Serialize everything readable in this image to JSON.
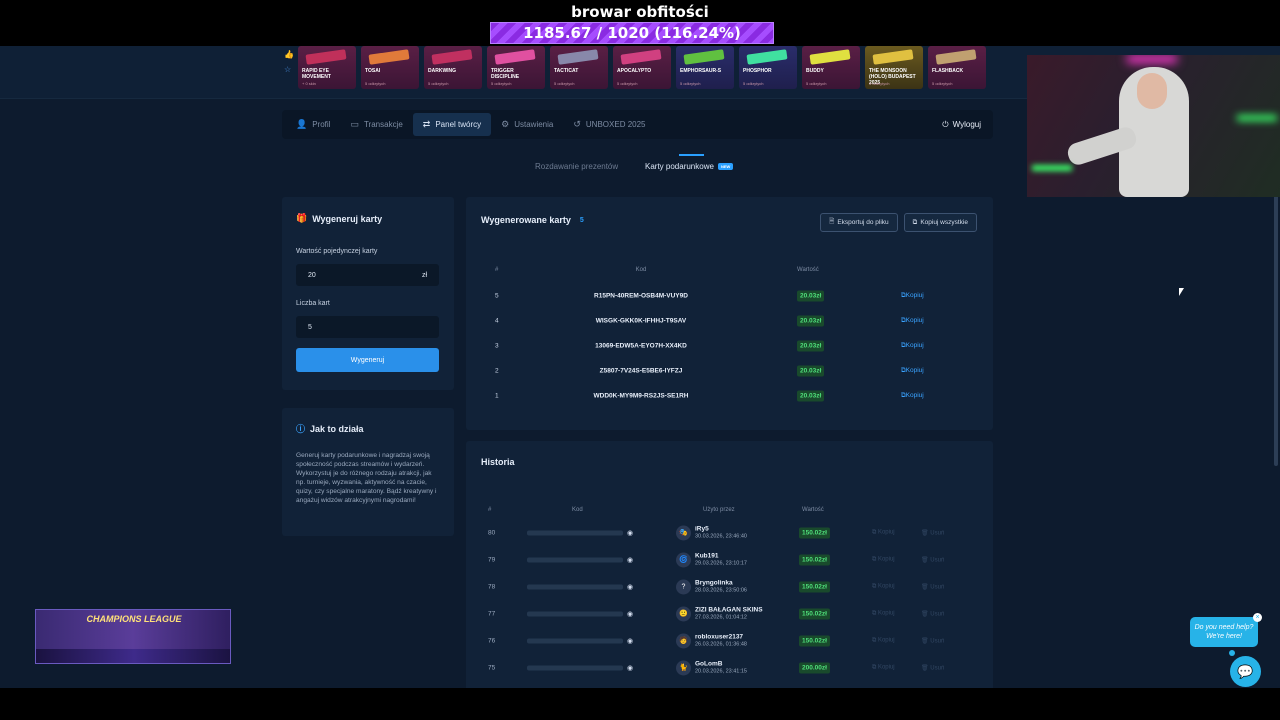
{
  "overlay": {
    "title": "browar obfitości",
    "progress_text": "1185.67 / 1020 (116.24%)",
    "progress_fraction": 1.1624
  },
  "skins": [
    {
      "name": "RAPID EYE MOVEMENT",
      "sub": "+ 0 skin",
      "color": "#c0305a"
    },
    {
      "name": "TOSAI",
      "sub": "5 odkrytych",
      "color": "#e07a3a"
    },
    {
      "name": "DARKWING",
      "sub": "5 odkrytych",
      "color": "#c03060"
    },
    {
      "name": "TRIGGER DISCIPLINE",
      "sub": "5 odkrytych",
      "color": "#e050a0"
    },
    {
      "name": "TACTICAT",
      "sub": "5 odkrytych",
      "color": "#8888aa"
    },
    {
      "name": "APOCALYPTO",
      "sub": "5 odkrytych",
      "color": "#d04080"
    },
    {
      "name": "EMPHORSAUR-S",
      "sub": "5 odkrytych",
      "color": "#60c040"
    },
    {
      "name": "PHOSPHOR",
      "sub": "5 odkrytych",
      "color": "#40e0a0"
    },
    {
      "name": "BUDDY",
      "sub": "5 odkrytych",
      "color": "#e0e040"
    },
    {
      "name": "THE MONSOON (HOLO) BUDAPEST 2025",
      "sub": "5 odkrytych",
      "color": "#e0c040"
    },
    {
      "name": "FLASHBACK",
      "sub": "5 odkrytych",
      "color": "#c0a070"
    }
  ],
  "tabs": [
    {
      "label": "Profil",
      "icon": "user-icon",
      "glyph": "👤"
    },
    {
      "label": "Transakcje",
      "icon": "wallet-icon",
      "glyph": "▭"
    },
    {
      "label": "Panel twórcy",
      "icon": "creator-icon",
      "glyph": "⇄"
    },
    {
      "label": "Ustawienia",
      "icon": "gear-icon",
      "glyph": "⚙"
    },
    {
      "label": "UNBOXED 2025",
      "icon": "history-icon",
      "glyph": "↺"
    }
  ],
  "logout_label": "Wyloguj",
  "subtabs": {
    "giveaways": "Rozdawanie prezentów",
    "gift_cards": "Karty podarunkowe",
    "new_badge": "NEW"
  },
  "generate": {
    "title": "Wygeneruj karty",
    "value_label": "Wartość pojedynczej karty",
    "value": "20",
    "currency": "zł",
    "count_label": "Liczba kart",
    "count": "5",
    "button": "Wygeneruj"
  },
  "how": {
    "title": "Jak to działa",
    "text": "Generuj karty podarunkowe i nagradzaj swoją społeczność podczas streamów i wydarzeń. Wykorzystuj je do różnego rodzaju atrakcji, jak np. turnieje, wyzwania, aktywność na czacie, quizy, czy specjalne maratony. Bądź kreatywny i angażuj widzów atrakcyjnymi nagrodami!"
  },
  "cards": {
    "title": "Wygenerowane karty",
    "count": "5",
    "export_label": "Eksportuj do pliku",
    "copy_all_label": "Kopiuj wszystkie",
    "headers": {
      "num": "#",
      "code": "Kod",
      "value": "Wartość"
    },
    "copy_label": "Kopiuj",
    "rows": [
      {
        "num": "5",
        "code": "R15PN-40REM-OSB4M-VUY9D",
        "value": "20.03zł"
      },
      {
        "num": "4",
        "code": "WISGK-GKK0K-IFHHJ-T9SAV",
        "value": "20.03zł"
      },
      {
        "num": "3",
        "code": "13069-EDW5A-EYO7H-XX4KD",
        "value": "20.03zł"
      },
      {
        "num": "2",
        "code": "Z5807-7V24S-E5BE6-IYFZJ",
        "value": "20.03zł"
      },
      {
        "num": "1",
        "code": "WDD0K-MY9M9-RS2JS-SE1RH",
        "value": "20.03zł"
      }
    ]
  },
  "history": {
    "title": "Historia",
    "headers": {
      "num": "#",
      "code": "Kod",
      "used_by": "Użyto przez",
      "value": "Wartość"
    },
    "copy_label": "Kopiuj",
    "delete_label": "Usuń",
    "rows": [
      {
        "num": "80",
        "user": "iRy5",
        "date": "30.03.2026, 23:46:40",
        "value": "150.02zł",
        "avatar": "🎭"
      },
      {
        "num": "79",
        "user": "Kub191",
        "date": "29.03.2026, 23:10:17",
        "value": "150.02zł",
        "avatar": "🌀"
      },
      {
        "num": "78",
        "user": "Bryngolinka",
        "date": "28.03.2026, 23:50:06",
        "value": "150.02zł",
        "avatar": "?"
      },
      {
        "num": "77",
        "user": "ZIZI BAŁAGAN SKINS",
        "date": "27.03.2026, 01:04:12",
        "value": "150.02zł",
        "avatar": "🙂"
      },
      {
        "num": "76",
        "user": "robloxuser2137",
        "date": "26.03.2026, 01:36:48",
        "value": "150.02zł",
        "avatar": "🧑"
      },
      {
        "num": "75",
        "user": "GoLomB",
        "date": "20.03.2026, 23:41:15",
        "value": "200.00zł",
        "avatar": "🐈"
      }
    ]
  },
  "overlay_bottom": {
    "champ_label": "CHAMPIONS LEAGUE"
  },
  "help": {
    "bubble": "Do you need help? We're here!"
  },
  "colors": {
    "accent": "#2a90ea",
    "value_green": "#4fe07a",
    "background": "#0d1b2e"
  }
}
